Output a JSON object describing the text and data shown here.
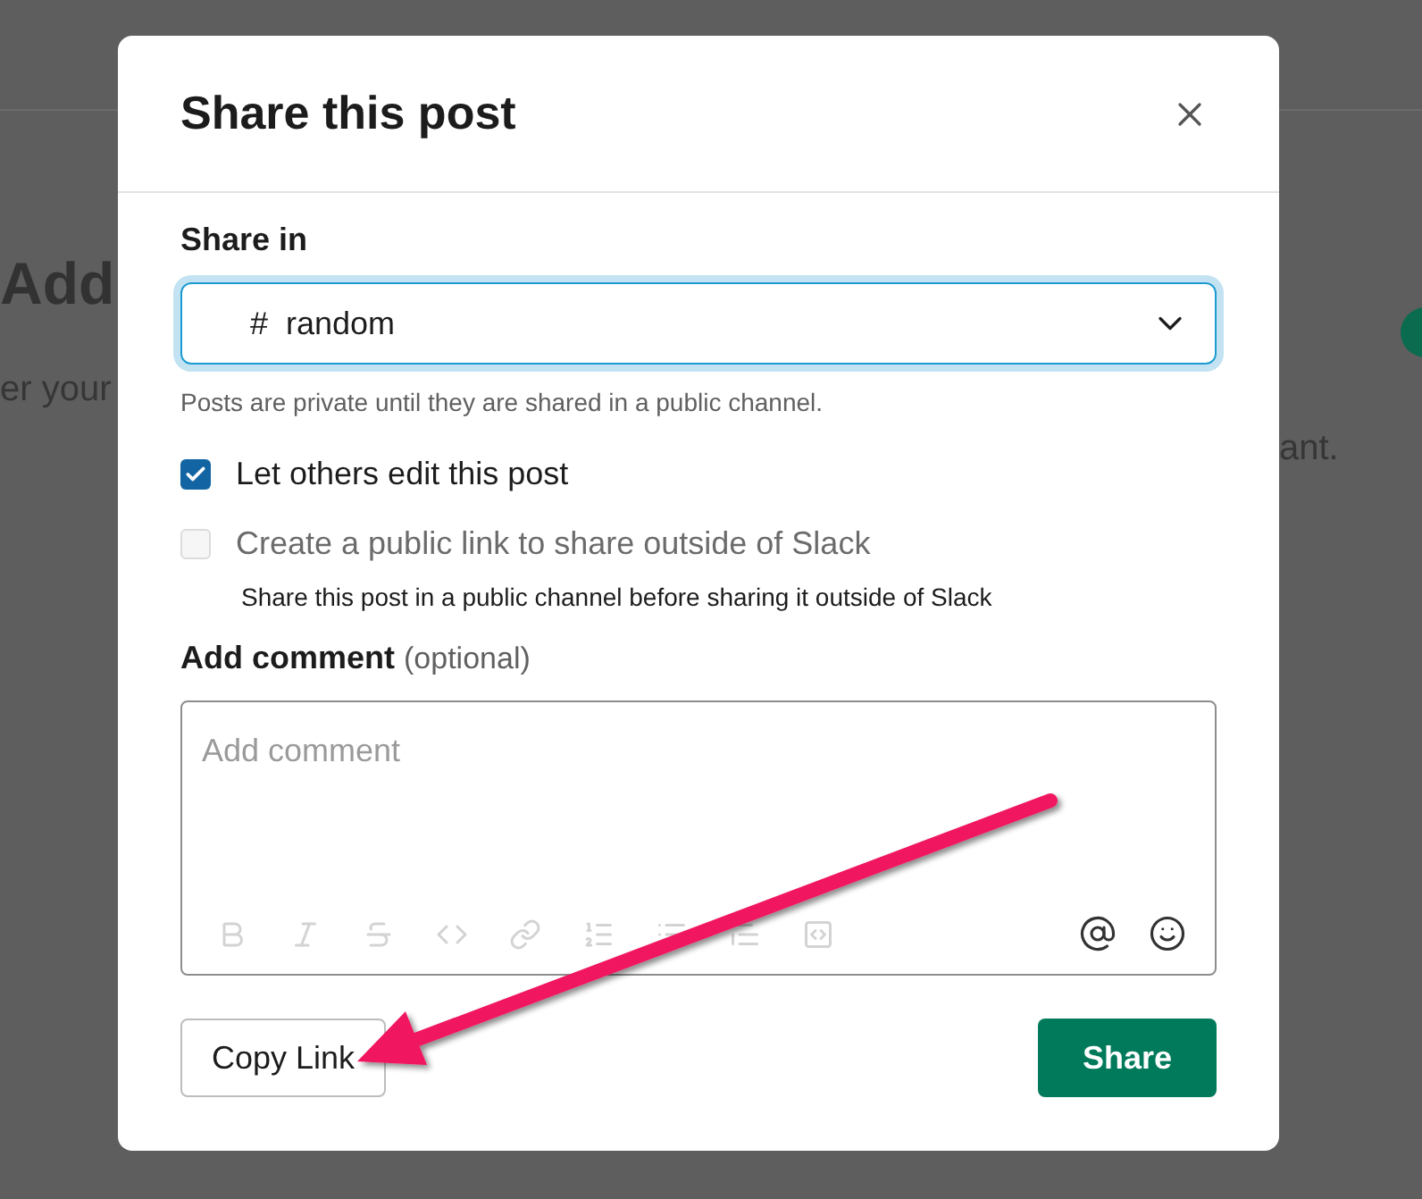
{
  "background": {
    "heading": "Add",
    "text_left": "er your",
    "text_right": "ant."
  },
  "dialog": {
    "title": "Share this post",
    "share_in": {
      "label": "Share in",
      "channel_prefix": "#",
      "channel": "random"
    },
    "hint": "Posts are private until they are shared in a public channel.",
    "options": [
      {
        "label": "Let others edit this post",
        "checked": true,
        "disabled": false
      },
      {
        "label": "Create a public link to share outside of Slack",
        "checked": false,
        "disabled": true,
        "note": "Share this post in a public channel before sharing it outside of Slack"
      }
    ],
    "comment": {
      "label": "Add comment",
      "label_note": "(optional)",
      "placeholder": "Add comment"
    },
    "buttons": [
      {
        "label": "Copy Link",
        "kind": "secondary"
      },
      {
        "label": "Share",
        "kind": "primary"
      }
    ]
  }
}
